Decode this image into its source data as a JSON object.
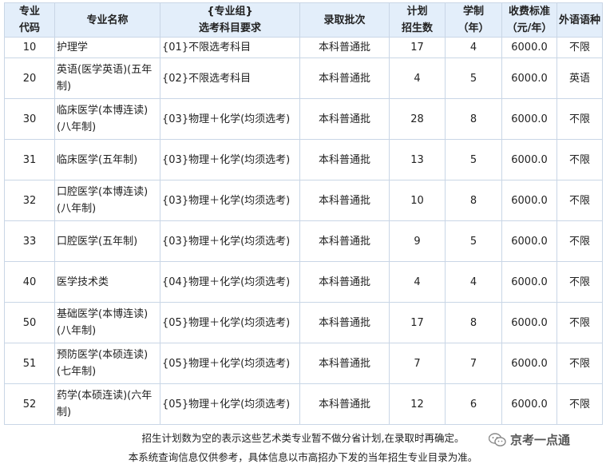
{
  "headers": [
    [
      "专业",
      "代码"
    ],
    [
      "专业名称"
    ],
    [
      "{专业组}",
      "选考科目要求"
    ],
    [
      "录取批次"
    ],
    [
      "计划",
      "招生数"
    ],
    [
      "学制",
      "（年）"
    ],
    [
      "收费标准",
      "（元/年）"
    ],
    [
      "外语语种"
    ]
  ],
  "rows": [
    {
      "code": "10",
      "name": "护理学",
      "group": "{01}不限选考科目",
      "batch": "本科普通批",
      "plan": "17",
      "years": "4",
      "fee": "6000.0",
      "lang": "不限"
    },
    {
      "code": "20",
      "name": "英语(医学英语)(五年制)",
      "group": "{02}不限选考科目",
      "batch": "本科普通批",
      "plan": "4",
      "years": "5",
      "fee": "6000.0",
      "lang": "英语"
    },
    {
      "code": "30",
      "name": "临床医学(本博连读)(八年制)",
      "group": "{03}物理＋化学(均须选考)",
      "batch": "本科普通批",
      "plan": "28",
      "years": "8",
      "fee": "6000.0",
      "lang": "不限"
    },
    {
      "code": "31",
      "name": "临床医学(五年制)",
      "group": "{03}物理＋化学(均须选考)",
      "batch": "本科普通批",
      "plan": "13",
      "years": "5",
      "fee": "6000.0",
      "lang": "不限"
    },
    {
      "code": "32",
      "name": "口腔医学(本博连读)(八年制)",
      "group": "{03}物理＋化学(均须选考)",
      "batch": "本科普通批",
      "plan": "10",
      "years": "8",
      "fee": "6000.0",
      "lang": "不限"
    },
    {
      "code": "33",
      "name": "口腔医学(五年制)",
      "group": "{03}物理＋化学(均须选考)",
      "batch": "本科普通批",
      "plan": "9",
      "years": "5",
      "fee": "6000.0",
      "lang": "不限"
    },
    {
      "code": "40",
      "name": "医学技术类",
      "group": "{04}物理＋化学(均须选考)",
      "batch": "本科普通批",
      "plan": "4",
      "years": "4",
      "fee": "6000.0",
      "lang": "不限"
    },
    {
      "code": "50",
      "name": "基础医学(本博连读)(八年制)",
      "group": "{05}物理＋化学(均须选考)",
      "batch": "本科普通批",
      "plan": "17",
      "years": "8",
      "fee": "6000.0",
      "lang": "不限"
    },
    {
      "code": "51",
      "name": "预防医学(本硕连读)(七年制)",
      "group": "{05}物理＋化学(均须选考)",
      "batch": "本科普通批",
      "plan": "7",
      "years": "7",
      "fee": "6000.0",
      "lang": "不限"
    },
    {
      "code": "52",
      "name": "药学(本硕连读)(六年制)",
      "group": "{05}物理＋化学(均须选考)",
      "batch": "本科普通批",
      "plan": "12",
      "years": "6",
      "fee": "6000.0",
      "lang": "不限"
    }
  ],
  "notes": {
    "line1": "招生计划数为空的表示这些艺术类专业暂不做分省计划,在录取时再确定。",
    "line2": "本系统查询信息仅供参考，具体信息以市高招办下发的当年招生专业目录为准。"
  },
  "watermark": {
    "text": "京考一点通",
    "icon": "wechat-icon",
    "color": "#666666"
  },
  "colors": {
    "header_bg": "#e3eefa",
    "border": "#c9d6e6"
  }
}
